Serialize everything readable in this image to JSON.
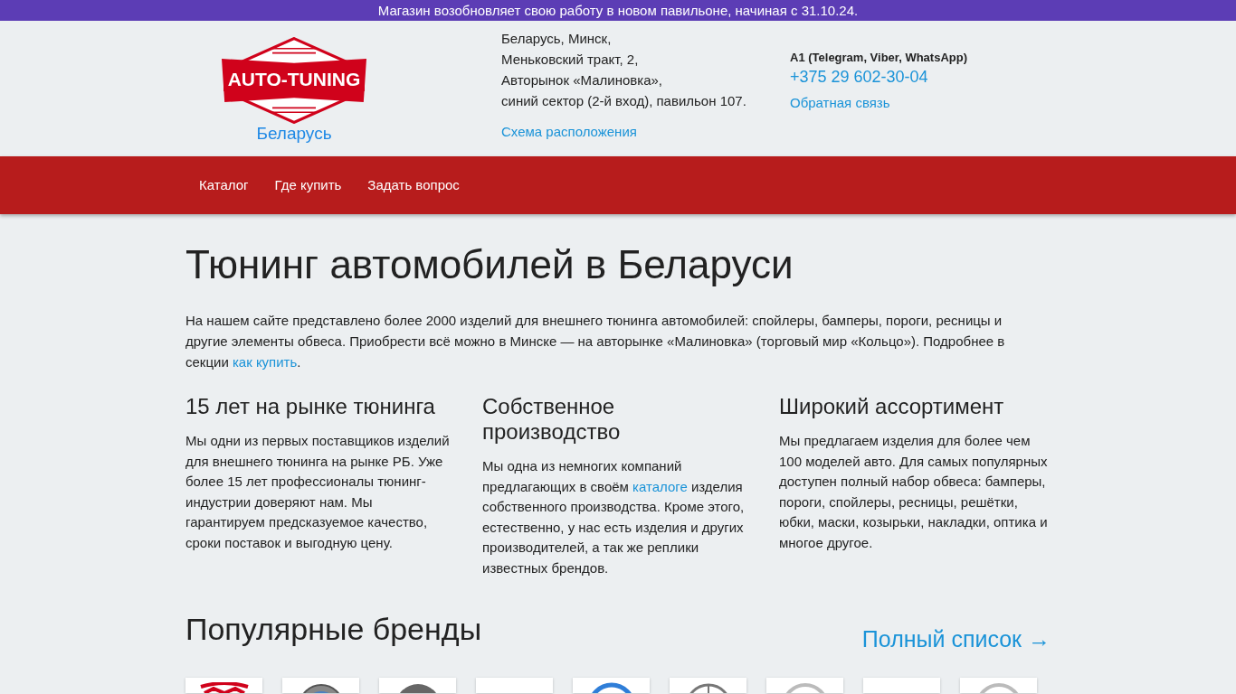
{
  "announcement": "Магазин возобновляет свою работу в новом павильоне, начиная с 31.10.24.",
  "header": {
    "logo_text": "AUTO-TUNING",
    "logo_subtitle": "Беларусь",
    "address_lines": [
      "Беларусь, Минск,",
      "Меньковский тракт, 2,",
      "Авторынок «Малиновка»,",
      "синий сектор (2-й вход), павильон 107."
    ],
    "map_link": "Схема расположения",
    "phone_label": "A1 (Telegram, Viber, WhatsApp)",
    "phone": "+375 29 602-30-04",
    "feedback_link": "Обратная связь"
  },
  "nav": [
    {
      "label": "Каталог"
    },
    {
      "label": "Где купить"
    },
    {
      "label": "Задать вопрос"
    }
  ],
  "title": "Тюнинг автомобилей в Беларуси",
  "intro": "На нашем сайте представлено более 2000 изделий для внешнего тюнинга автомобилей: спойлеры, бамперы, пороги, ресницы и другие элементы обвеса. Приобрести всё можно в Минске — на авторынке «Малиновка» (торговый мир «Кольцо»). Подробнее в секции ",
  "intro_link": "как купить",
  "intro_end": ".",
  "features": [
    {
      "title": "15 лет на рынке тюнинга",
      "text": "Мы одни из первых поставщиков изделий для внешнего тюнинга на рынке РБ. Уже более 15 лет профессионалы тюнинг-индустрии доверяют нам. Мы гарантируем предсказуемое качество, сроки поставок и выгодную цену."
    },
    {
      "title": "Собственное производство",
      "text": "Мы одна из немногих компаний предлагающих в своём ",
      "link": "каталоге",
      "text_after": " изделия собственного производства. Кроме этого, естественно, у нас есть изделия и других производителей, а так же реплики известных брендов."
    },
    {
      "title": "Широкий ассортимент",
      "text": "Мы предлагаем изделия для более чем 100 моделей авто. Для самых популярных доступен полный набор обвеса: бамперы, пороги, спойлеры, ресницы, решётки, юбки, маски, козырьки, накладки, оптика и многое другое."
    }
  ],
  "brands_title": "Популярные бренды",
  "brands_link": "Полный список →",
  "brand_tiles": [
    {
      "kind": "red"
    },
    {
      "kind": "ring"
    },
    {
      "kind": "dark"
    },
    {
      "kind": "blank"
    },
    {
      "kind": "blue"
    },
    {
      "kind": "star"
    },
    {
      "kind": "grey"
    },
    {
      "kind": "blank"
    },
    {
      "kind": "grey"
    }
  ]
}
